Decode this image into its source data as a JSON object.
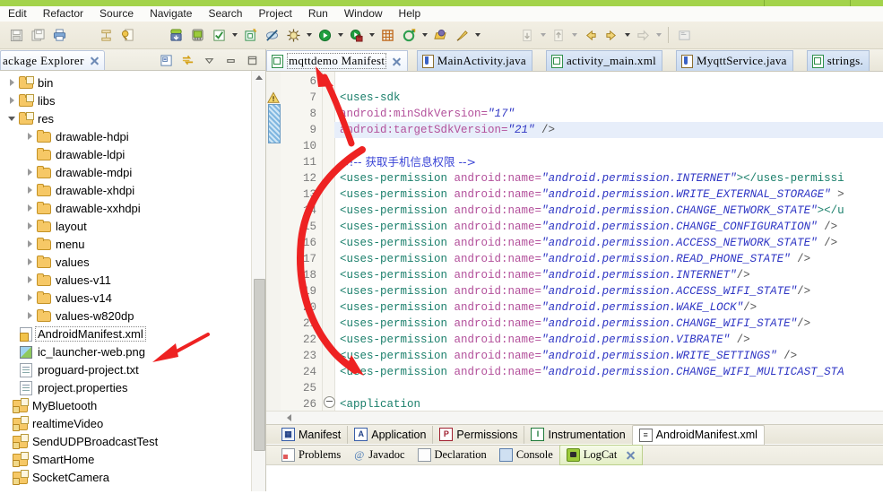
{
  "menu": {
    "items": [
      "Edit",
      "Refactor",
      "Source",
      "Navigate",
      "Search",
      "Project",
      "Run",
      "Window",
      "Help"
    ]
  },
  "toolbar": {
    "buttons": [
      {
        "name": "save-icon",
        "glyph": "💾"
      },
      {
        "name": "save-all-icon",
        "glyph": "🖫"
      },
      {
        "name": "print-icon",
        "glyph": "🖨"
      },
      {
        "name": "toggle-mark-occurrences-icon",
        "glyph": "☰"
      },
      {
        "name": "external-tools-icon",
        "glyph": "⚒"
      },
      {
        "name": "android-sdk-manager-icon",
        "glyph": "↓"
      },
      {
        "name": "android-virtual-device-manager-icon",
        "glyph": "▣"
      },
      {
        "name": "lint-warnings-icon",
        "glyph": "✓"
      },
      {
        "name": "new-android-project-icon",
        "glyph": "▦"
      },
      {
        "name": "skip-breakpoints-icon",
        "glyph": "⊘"
      },
      {
        "name": "debug-icon",
        "glyph": "✶"
      },
      {
        "name": "run-icon",
        "glyph": "▶"
      },
      {
        "name": "run-history-icon",
        "glyph": "●"
      },
      {
        "name": "new-java-package-icon",
        "glyph": "⊞"
      },
      {
        "name": "new-java-class-icon",
        "glyph": "C"
      },
      {
        "name": "open-type-icon",
        "glyph": "◑"
      },
      {
        "name": "search-icon",
        "glyph": "✎"
      },
      {
        "name": "next-annotation-icon",
        "glyph": "⇩"
      },
      {
        "name": "previous-annotation-icon",
        "glyph": "⇧"
      },
      {
        "name": "back-icon",
        "glyph": "↩"
      },
      {
        "name": "forward-icon",
        "glyph": "↪"
      },
      {
        "name": "next-edit-icon",
        "glyph": "⇨"
      },
      {
        "name": "pin-editor-icon",
        "glyph": "▤"
      }
    ]
  },
  "explorer": {
    "title": "ackage Explorer",
    "tools": [
      {
        "name": "collapse-all-icon"
      },
      {
        "name": "link-with-editor-icon"
      },
      {
        "name": "view-menu-icon"
      },
      {
        "name": "minimize-view-icon"
      },
      {
        "name": "maximize-view-icon"
      }
    ],
    "tree": [
      {
        "label": "bin",
        "indent": 0,
        "twisty": "closed",
        "icon": "package-folder"
      },
      {
        "label": "libs",
        "indent": 0,
        "twisty": "closed",
        "icon": "package-folder"
      },
      {
        "label": "res",
        "indent": 0,
        "twisty": "open",
        "icon": "package-folder"
      },
      {
        "label": "drawable-hdpi",
        "indent": 1,
        "twisty": "closed",
        "icon": "folder"
      },
      {
        "label": "drawable-ldpi",
        "indent": 1,
        "twisty": "none",
        "icon": "folder"
      },
      {
        "label": "drawable-mdpi",
        "indent": 1,
        "twisty": "closed",
        "icon": "folder"
      },
      {
        "label": "drawable-xhdpi",
        "indent": 1,
        "twisty": "closed",
        "icon": "folder"
      },
      {
        "label": "drawable-xxhdpi",
        "indent": 1,
        "twisty": "closed",
        "icon": "folder"
      },
      {
        "label": "layout",
        "indent": 1,
        "twisty": "closed",
        "icon": "folder"
      },
      {
        "label": "menu",
        "indent": 1,
        "twisty": "closed",
        "icon": "folder"
      },
      {
        "label": "values",
        "indent": 1,
        "twisty": "closed",
        "icon": "folder"
      },
      {
        "label": "values-v11",
        "indent": 1,
        "twisty": "closed",
        "icon": "folder"
      },
      {
        "label": "values-v14",
        "indent": 1,
        "twisty": "closed",
        "icon": "folder"
      },
      {
        "label": "values-w820dp",
        "indent": 1,
        "twisty": "closed",
        "icon": "folder"
      },
      {
        "label": "AndroidManifest.xml",
        "indent": 0,
        "twisty": "none",
        "icon": "xml-file",
        "selected": true
      },
      {
        "label": "ic_launcher-web.png",
        "indent": 0,
        "twisty": "none",
        "icon": "image-file"
      },
      {
        "label": "proguard-project.txt",
        "indent": 0,
        "twisty": "none",
        "icon": "text-file"
      },
      {
        "label": "project.properties",
        "indent": 0,
        "twisty": "none",
        "icon": "text-file"
      },
      {
        "label": "MyBluetooth",
        "indent": -1,
        "twisty": "none",
        "icon": "project"
      },
      {
        "label": "realtimeVideo",
        "indent": -1,
        "twisty": "none",
        "icon": "project"
      },
      {
        "label": "SendUDPBroadcastTest",
        "indent": -1,
        "twisty": "none",
        "icon": "project"
      },
      {
        "label": "SmartHome",
        "indent": -1,
        "twisty": "none",
        "icon": "project"
      },
      {
        "label": "SocketCamera",
        "indent": -1,
        "twisty": "none",
        "icon": "project"
      }
    ]
  },
  "editor": {
    "tabs": [
      {
        "label": "mqttdemo Manifest",
        "icon": "xml",
        "active": true,
        "closable": true
      },
      {
        "label": "MainActivity.java",
        "icon": "java",
        "active": false,
        "closable": false
      },
      {
        "label": "activity_main.xml",
        "icon": "xml",
        "active": false,
        "closable": false
      },
      {
        "label": "MyqttService.java",
        "icon": "java",
        "active": false,
        "closable": false
      },
      {
        "label": "strings.",
        "icon": "xml",
        "active": false,
        "closable": false
      }
    ],
    "line_numbers": [
      "6",
      "7",
      "8",
      "9",
      "10",
      "11",
      "12",
      "13",
      "14",
      "15",
      "16",
      "17",
      "18",
      "19",
      "20",
      "21",
      "22",
      "23",
      "24",
      "25",
      "26"
    ],
    "lines": [
      {
        "n": "6",
        "segs": []
      },
      {
        "n": "7",
        "segs": [
          {
            "t": "    ",
            "c": "pl"
          },
          {
            "t": "<uses-sdk",
            "c": "tg"
          }
        ],
        "marker": "warning"
      },
      {
        "n": "8",
        "segs": [
          {
            "t": "        ",
            "c": "pl"
          },
          {
            "t": "android:minSdkVersion=",
            "c": "at"
          },
          {
            "t": "\"17\"",
            "c": "st"
          }
        ]
      },
      {
        "n": "9",
        "segs": [
          {
            "t": "        ",
            "c": "pl"
          },
          {
            "t": "android:targetSdkVersion=",
            "c": "at"
          },
          {
            "t": "\"21\"",
            "c": "st"
          },
          {
            "t": " />",
            "c": "pl"
          }
        ],
        "highlight": true
      },
      {
        "n": "10",
        "segs": []
      },
      {
        "n": "11",
        "segs": [
          {
            "t": "    ",
            "c": "pl"
          },
          {
            "t": "<!--      获取手机信息权限 -->",
            "c": "cm"
          }
        ]
      },
      {
        "n": "12",
        "segs": [
          {
            "t": "    ",
            "c": "pl"
          },
          {
            "t": "<uses-permission ",
            "c": "tg"
          },
          {
            "t": "android:name=",
            "c": "at"
          },
          {
            "t": "\"android.permission.INTERNET\"",
            "c": "st"
          },
          {
            "t": "></uses-permissi",
            "c": "tg"
          }
        ]
      },
      {
        "n": "13",
        "segs": [
          {
            "t": "    ",
            "c": "pl"
          },
          {
            "t": "<uses-permission ",
            "c": "tg"
          },
          {
            "t": "android:name=",
            "c": "at"
          },
          {
            "t": "\"android.permission.WRITE_EXTERNAL_STORAGE\"",
            "c": "st"
          },
          {
            "t": " >",
            "c": "pl"
          }
        ]
      },
      {
        "n": "14",
        "segs": [
          {
            "t": "    ",
            "c": "pl"
          },
          {
            "t": "<uses-permission ",
            "c": "tg"
          },
          {
            "t": "android:name=",
            "c": "at"
          },
          {
            "t": "\"android.permission.CHANGE_NETWORK_STATE\"",
            "c": "st"
          },
          {
            "t": "></u",
            "c": "tg"
          }
        ]
      },
      {
        "n": "15",
        "segs": [
          {
            "t": "    ",
            "c": "pl"
          },
          {
            "t": "<uses-permission ",
            "c": "tg"
          },
          {
            "t": "android:name=",
            "c": "at"
          },
          {
            "t": "\"android.permission.CHANGE_CONFIGURATION\"",
            "c": "st"
          },
          {
            "t": " />",
            "c": "pl"
          }
        ]
      },
      {
        "n": "16",
        "segs": [
          {
            "t": "    ",
            "c": "pl"
          },
          {
            "t": "<uses-permission ",
            "c": "tg"
          },
          {
            "t": "android:name=",
            "c": "at"
          },
          {
            "t": "\"android.permission.ACCESS_NETWORK_STATE\"",
            "c": "st"
          },
          {
            "t": " />",
            "c": "pl"
          }
        ]
      },
      {
        "n": "17",
        "segs": [
          {
            "t": "    ",
            "c": "pl"
          },
          {
            "t": "<uses-permission ",
            "c": "tg"
          },
          {
            "t": "android:name=",
            "c": "at"
          },
          {
            "t": "\"android.permission.READ_PHONE_STATE\"",
            "c": "st"
          },
          {
            "t": " />",
            "c": "pl"
          }
        ]
      },
      {
        "n": "18",
        "segs": [
          {
            "t": "    ",
            "c": "pl"
          },
          {
            "t": "<uses-permission ",
            "c": "tg"
          },
          {
            "t": "android:name=",
            "c": "at"
          },
          {
            "t": "\"android.permission.INTERNET\"",
            "c": "st"
          },
          {
            "t": "/>",
            "c": "pl"
          }
        ]
      },
      {
        "n": "19",
        "segs": [
          {
            "t": "    ",
            "c": "pl"
          },
          {
            "t": "<uses-permission ",
            "c": "tg"
          },
          {
            "t": "android:name=",
            "c": "at"
          },
          {
            "t": "\"android.permission.ACCESS_WIFI_STATE\"",
            "c": "st"
          },
          {
            "t": "/>",
            "c": "pl"
          }
        ]
      },
      {
        "n": "20",
        "segs": [
          {
            "t": "    ",
            "c": "pl"
          },
          {
            "t": "<uses-permission ",
            "c": "tg"
          },
          {
            "t": "android:name=",
            "c": "at"
          },
          {
            "t": "\"android.permission.WAKE_LOCK\"",
            "c": "st"
          },
          {
            "t": "/>",
            "c": "pl"
          }
        ]
      },
      {
        "n": "21",
        "segs": [
          {
            "t": "    ",
            "c": "pl"
          },
          {
            "t": "<uses-permission ",
            "c": "tg"
          },
          {
            "t": "android:name=",
            "c": "at"
          },
          {
            "t": "\"android.permission.CHANGE_WIFI_STATE\"",
            "c": "st"
          },
          {
            "t": "/>",
            "c": "pl"
          }
        ]
      },
      {
        "n": "22",
        "segs": [
          {
            "t": "    ",
            "c": "pl"
          },
          {
            "t": "<uses-permission ",
            "c": "tg"
          },
          {
            "t": "android:name=",
            "c": "at"
          },
          {
            "t": "\"android.permission.VIBRATE\"",
            "c": "st"
          },
          {
            "t": " />",
            "c": "pl"
          }
        ]
      },
      {
        "n": "23",
        "segs": [
          {
            "t": "    ",
            "c": "pl"
          },
          {
            "t": "<uses-permission ",
            "c": "tg"
          },
          {
            "t": "android:name=",
            "c": "at"
          },
          {
            "t": "\"android.permission.WRITE_SETTINGS\"",
            "c": "st"
          },
          {
            "t": " />",
            "c": "pl"
          }
        ]
      },
      {
        "n": "24",
        "segs": [
          {
            "t": "    ",
            "c": "pl"
          },
          {
            "t": "<uses-permission ",
            "c": "tg"
          },
          {
            "t": "android:name=",
            "c": "at"
          },
          {
            "t": "\"android.permission.CHANGE_WIFI_MULTICAST_STA",
            "c": "st"
          }
        ]
      },
      {
        "n": "25",
        "segs": []
      },
      {
        "n": "26",
        "segs": [
          {
            "t": "    ",
            "c": "pl"
          },
          {
            "t": "<application",
            "c": "tg"
          }
        ],
        "fold": true
      }
    ],
    "form_tabs": [
      {
        "label": "Manifest",
        "icon": "grid",
        "letter": "▦",
        "active": false
      },
      {
        "label": "Application",
        "icon": "a",
        "letter": "A",
        "active": false
      },
      {
        "label": "Permissions",
        "icon": "p",
        "letter": "P",
        "active": false
      },
      {
        "label": "Instrumentation",
        "icon": "i",
        "letter": "I",
        "active": false
      },
      {
        "label": "AndroidManifest.xml",
        "icon": "x",
        "letter": "≡",
        "active": true
      }
    ]
  },
  "bottom": {
    "tabs": [
      {
        "label": "Problems",
        "icon": "problems",
        "active": false,
        "closable": false
      },
      {
        "label": "Javadoc",
        "icon": "javadoc",
        "active": false,
        "closable": false
      },
      {
        "label": "Declaration",
        "icon": "decl",
        "active": false,
        "closable": false
      },
      {
        "label": "Console",
        "icon": "console",
        "active": false,
        "closable": false
      },
      {
        "label": "LogCat",
        "icon": "logcat",
        "active": true,
        "closable": true
      }
    ]
  },
  "annotations": {
    "color": "#ee2222",
    "shapes": [
      "arrow-to-editor-tab",
      "curve-bracket-permissions",
      "arrow-to-manifest-file"
    ]
  }
}
